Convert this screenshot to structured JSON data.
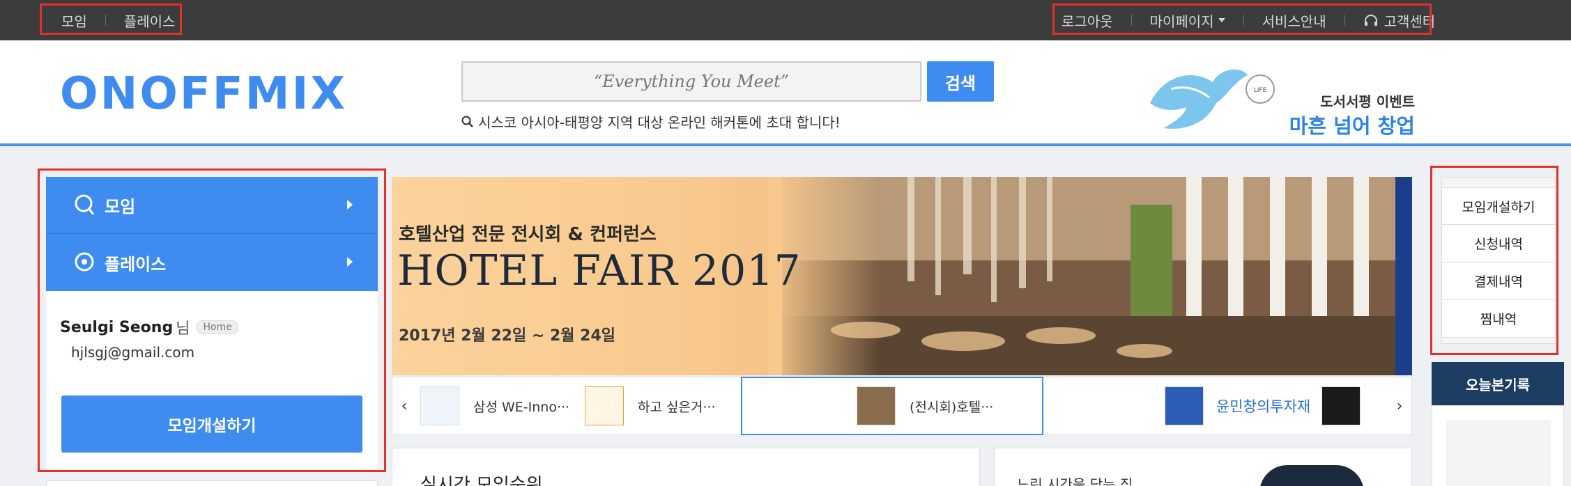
{
  "topbar": {
    "left_links": [
      "모임",
      "플레이스"
    ],
    "logout": "로그아웃",
    "mypage": "마이페이지",
    "service": "서비스안내",
    "support": "고객센터"
  },
  "header": {
    "logo": "onoffmix",
    "search_placeholder": "“Everything You Meet”",
    "search_button": "검색",
    "search_hint": "시스코 아시아-태평양 지역 대상 온라인 해커톤에 초대 합니다!",
    "event_sub": "도서서평 이벤트",
    "event_main": "마흔 넘어 창업"
  },
  "left_panel": {
    "nav": [
      "모임",
      "플레이스"
    ],
    "user_name": "Seulgi Seong",
    "user_suffix": "님",
    "home_badge": "Home",
    "email": "hjlsgj@gmail.com",
    "create_button": "모임개설하기"
  },
  "banner": {
    "subtitle": "호텔산업 전문 전시회 & 컨퍼런스",
    "title": "HOTEL FAIR 2017",
    "date": "2017년 2월 22일 ~ 2월 24일"
  },
  "thumbs": {
    "items": [
      "삼성 WE-Inno···",
      "하고 싶은거···",
      "(전시회)호텔···",
      "윤민창의투자재"
    ],
    "prev": "‹",
    "next": "›"
  },
  "cards": {
    "ranking_title": "실시간 모임순위",
    "promo_text": "느린 시간을 담는 집"
  },
  "right_panel": {
    "items": [
      "모임개설하기",
      "신청내역",
      "결제내역",
      "찜내역"
    ],
    "history_title": "오늘본기록"
  },
  "colors": {
    "brand_blue": "#3e8cf0",
    "topbar_bg": "#3c3c3c",
    "annotation_red": "#e2312b",
    "history_navy": "#1d3d63"
  }
}
